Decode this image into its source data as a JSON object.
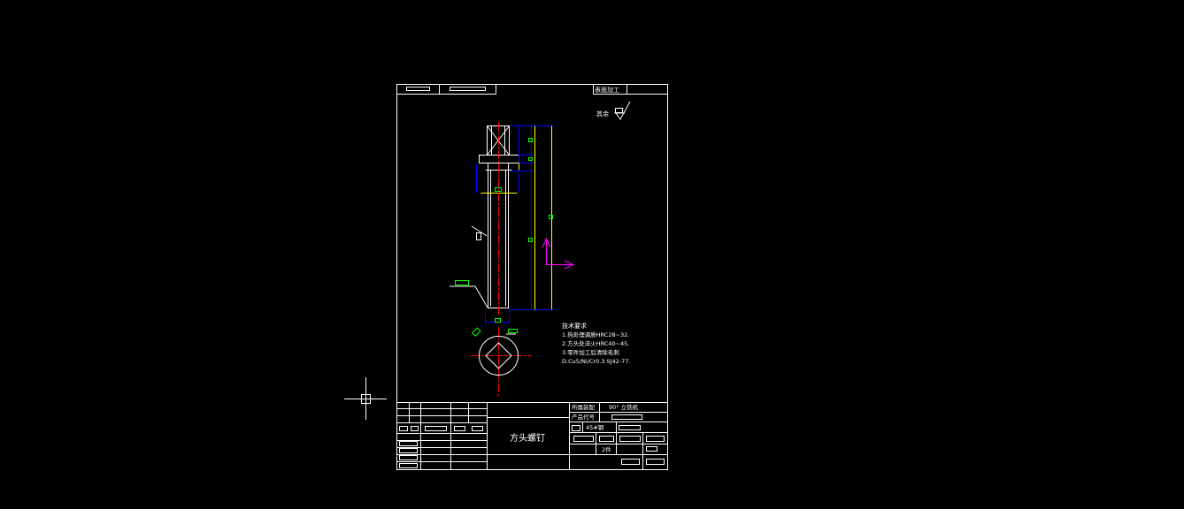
{
  "header": {
    "surface_label": "表面加工"
  },
  "roughness_note": "其余",
  "technical_requirements": {
    "title": "技术要求",
    "items": [
      "1.热处理调质HRC28~32.",
      "2.方头处淬火HRC40~45.",
      "3.零件加工后清除毛刺",
      "D.Cu5/Ni/Cr0.3  SJ42-77."
    ]
  },
  "title_block": {
    "part_name": "方头螺钉",
    "project_label": "所属装配",
    "project_value": "90° 立铣机",
    "product_code_label": "产品代号",
    "material": "45#钢",
    "quantity": "2件"
  },
  "colors": {
    "background": "#000000",
    "outline": "#ffffff",
    "dimension": "#0000ff",
    "center_line": "#ff0000",
    "extension": "#ffff00",
    "marker": "#00ff00",
    "ucs_icon": "#ff00ff"
  }
}
